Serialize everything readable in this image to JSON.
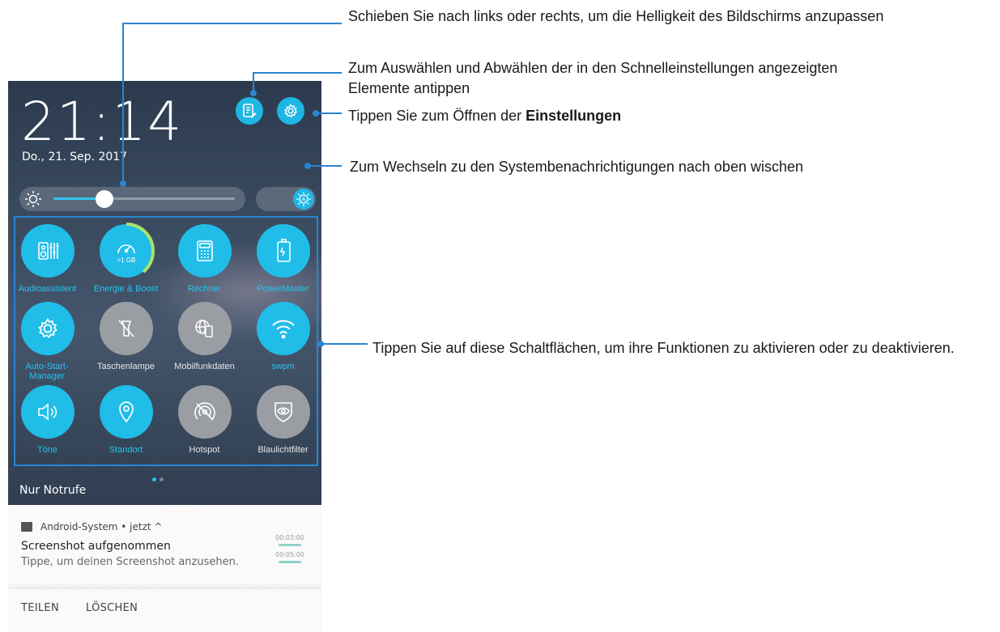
{
  "phone": {
    "time": "21:14",
    "date": "Do., 21. Sep. 2017",
    "brightness_level": 0.28,
    "tiles": [
      {
        "label": "Audioassistent",
        "state": "on",
        "icon": "audio-equalizer-icon"
      },
      {
        "label": "Energie & Boost",
        "state": "on",
        "icon": "speedometer-icon",
        "badge": ">1 GB"
      },
      {
        "label": "Rechner",
        "state": "on",
        "icon": "calculator-icon"
      },
      {
        "label": "PowerMaster",
        "state": "on",
        "icon": "battery-icon"
      },
      {
        "label": "Auto-Start-Manager",
        "state": "on",
        "icon": "gear-icon"
      },
      {
        "label": "Taschenlampe",
        "state": "off",
        "icon": "flashlight-icon"
      },
      {
        "label": "Mobilfunkdaten",
        "state": "off",
        "icon": "globe-phone-icon"
      },
      {
        "label": "swpm",
        "state": "on",
        "icon": "wifi-icon"
      },
      {
        "label": "Töne",
        "state": "on",
        "icon": "speaker-icon"
      },
      {
        "label": "Standort",
        "state": "on",
        "icon": "location-pin-icon"
      },
      {
        "label": "Hotspot",
        "state": "off",
        "icon": "hotspot-icon"
      },
      {
        "label": "Blaulichtfilter",
        "state": "off",
        "icon": "eye-shield-icon"
      }
    ],
    "emergency_text": "Nur Notrufe",
    "notification": {
      "app": "Android-System • jetzt ^",
      "title": "Screenshot aufgenommen",
      "body": "Tippe, um deinen Screenshot anzusehen.",
      "thumb_time_1": "00:03:00",
      "thumb_time_2": "00:05:00",
      "action_share": "TEILEN",
      "action_delete": "LÖSCHEN"
    }
  },
  "callouts": {
    "brightness": "Schieben Sie nach links oder rechts, um die Helligkeit des Bildschirms anzupassen",
    "edit_quick_settings": "Zum Auswählen und Abwählen der in den Schnelleinstellungen angezeigten Elemente antippen",
    "settings_prefix": "Tippen Sie zum Öffnen der ",
    "settings_bold": "Einstellungen",
    "swipe_up": "Zum Wechseln zu den Systembenachrichtigungen nach oben wischen",
    "toggles": "Tippen Sie auf diese Schaltflächen, um ihre Funktionen zu aktivieren oder zu deaktivieren."
  },
  "colors": {
    "accent": "#20bde9",
    "callout_line": "#2a85cf",
    "tile_off": "#9a9da2"
  }
}
